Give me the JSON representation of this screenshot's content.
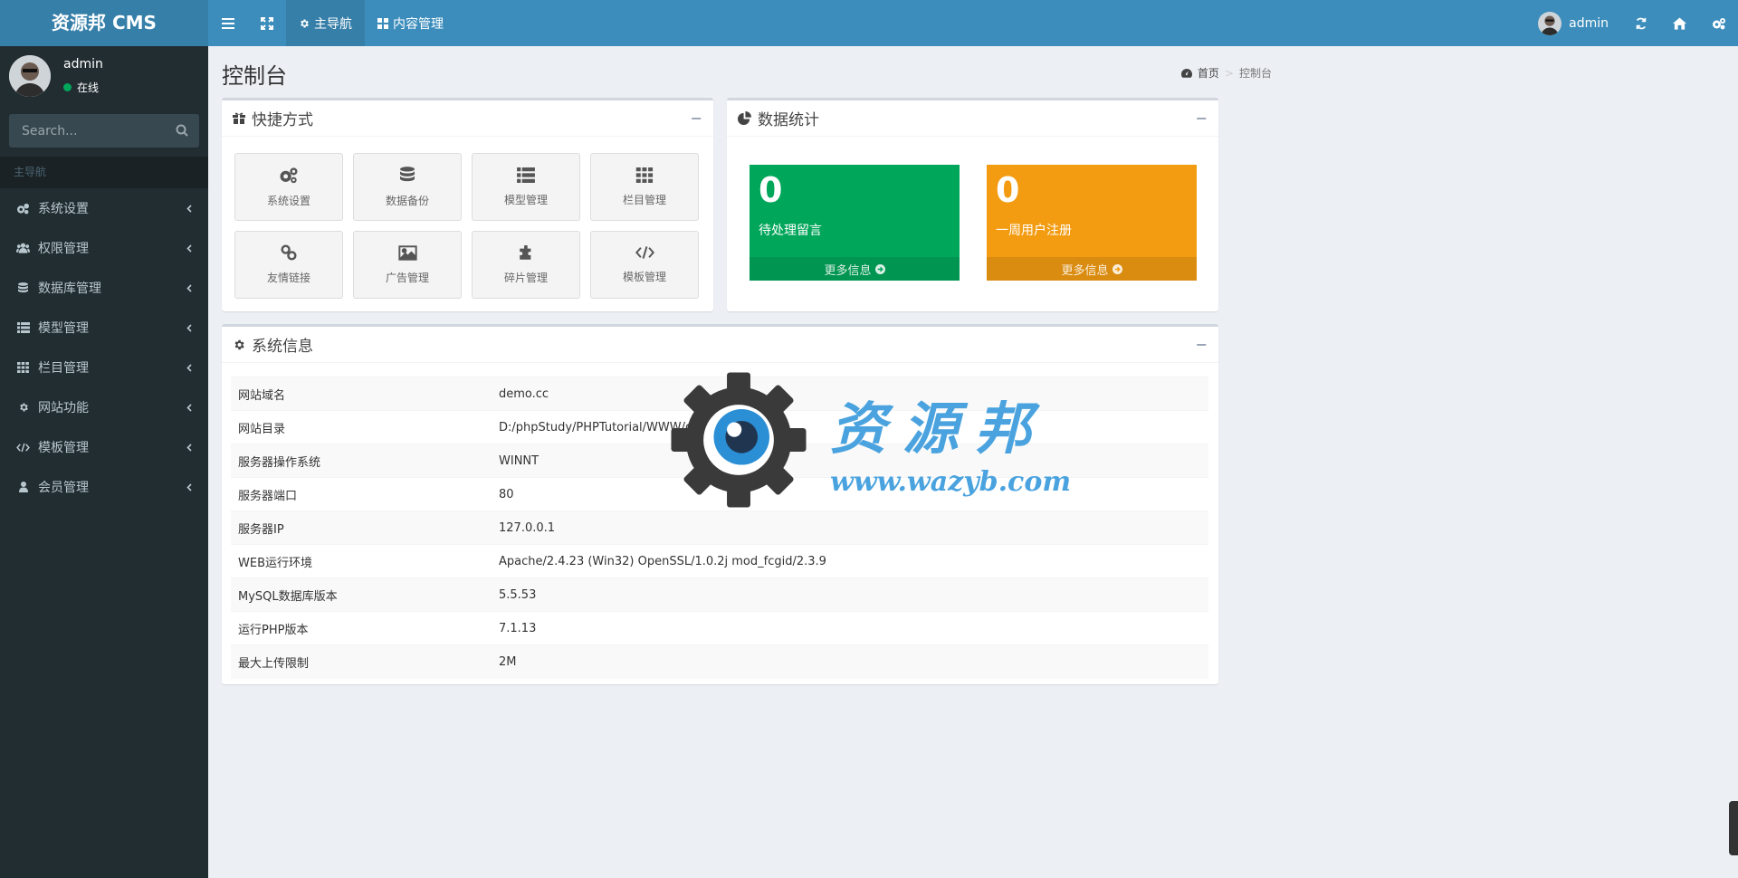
{
  "header": {
    "logo_text": "资源邦 CMS",
    "nav_tabs": [
      {
        "label": "主导航",
        "icon": "gear-icon",
        "active": true
      },
      {
        "label": "内容管理",
        "icon": "grid-icon",
        "active": false
      }
    ],
    "user_name": "admin"
  },
  "sidebar": {
    "user": {
      "name": "admin",
      "status": "在线"
    },
    "search_placeholder": "Search...",
    "menu_header": "主导航",
    "items": [
      {
        "label": "系统设置",
        "icon": "cogs-icon"
      },
      {
        "label": "权限管理",
        "icon": "users-icon"
      },
      {
        "label": "数据库管理",
        "icon": "database-icon"
      },
      {
        "label": "模型管理",
        "icon": "list-icon"
      },
      {
        "label": "栏目管理",
        "icon": "grid-icon"
      },
      {
        "label": "网站功能",
        "icon": "gear-icon"
      },
      {
        "label": "模板管理",
        "icon": "code-icon"
      },
      {
        "label": "会员管理",
        "icon": "user-icon"
      }
    ]
  },
  "page": {
    "title": "控制台",
    "breadcrumb": {
      "home": "首页",
      "current": "控制台"
    }
  },
  "shortcuts": {
    "title": "快捷方式",
    "items": [
      {
        "label": "系统设置",
        "icon": "cogs-icon"
      },
      {
        "label": "数据备份",
        "icon": "database-icon"
      },
      {
        "label": "模型管理",
        "icon": "list-icon"
      },
      {
        "label": "栏目管理",
        "icon": "grid-icon"
      },
      {
        "label": "友情链接",
        "icon": "link-icon"
      },
      {
        "label": "广告管理",
        "icon": "image-icon"
      },
      {
        "label": "碎片管理",
        "icon": "puzzle-icon"
      },
      {
        "label": "模板管理",
        "icon": "code-icon"
      }
    ]
  },
  "stats": {
    "title": "数据统计",
    "cards": [
      {
        "value": "0",
        "label": "待处理留言",
        "more": "更多信息",
        "color": "#00a65a"
      },
      {
        "value": "0",
        "label": "一周用户注册",
        "more": "更多信息",
        "color": "#f39c12"
      }
    ]
  },
  "sysinfo": {
    "title": "系统信息",
    "rows": [
      {
        "key": "网站域名",
        "value": "demo.cc"
      },
      {
        "key": "网站目录",
        "value": "D:/phpStudy/PHPTutorial/WWW/demo/"
      },
      {
        "key": "服务器操作系统",
        "value": "WINNT"
      },
      {
        "key": "服务器端口",
        "value": "80"
      },
      {
        "key": "服务器IP",
        "value": "127.0.0.1"
      },
      {
        "key": "WEB运行环境",
        "value": "Apache/2.4.23 (Win32) OpenSSL/1.0.2j mod_fcgid/2.3.9"
      },
      {
        "key": "MySQL数据库版本",
        "value": "5.5.53"
      },
      {
        "key": "运行PHP版本",
        "value": "7.1.13"
      },
      {
        "key": "最大上传限制",
        "value": "2M"
      }
    ]
  },
  "watermark": {
    "title": "资源邦",
    "url": "www.wazyb.com"
  },
  "colors": {
    "header": "#3c8dbc",
    "logo": "#367fa9",
    "sidebar": "#222d32",
    "accent": "#4aa3df"
  }
}
